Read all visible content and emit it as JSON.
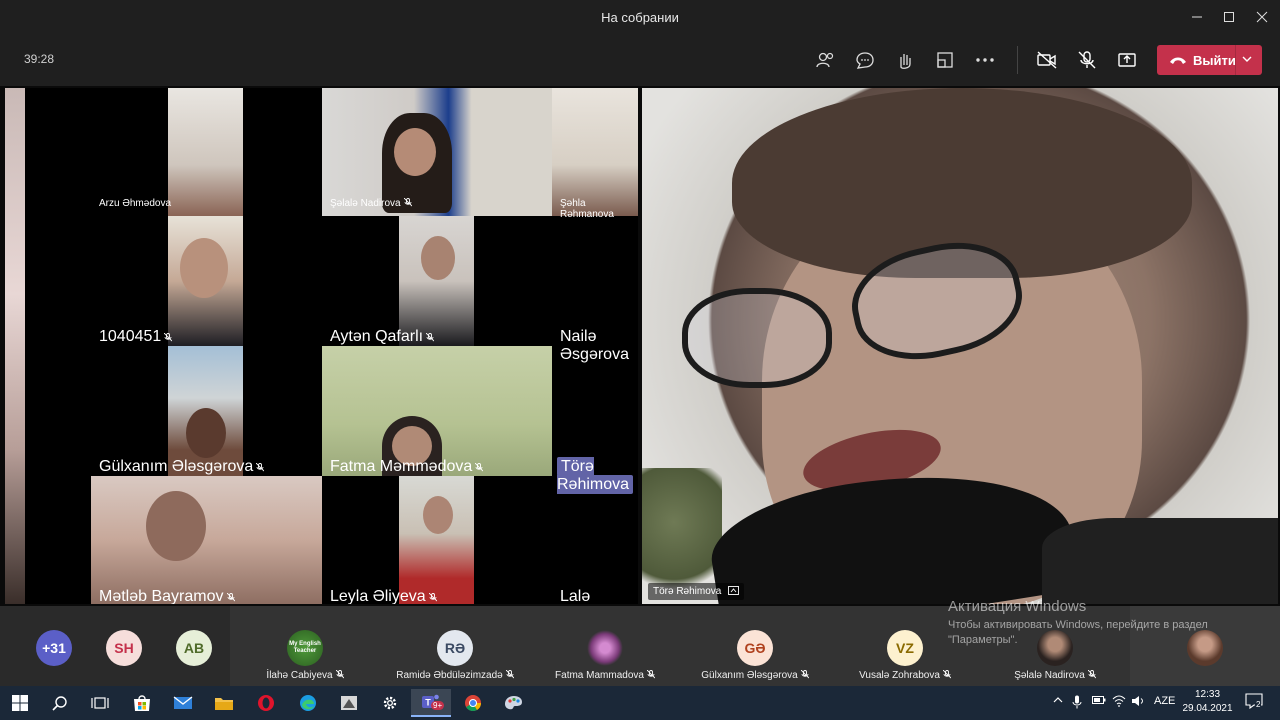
{
  "window": {
    "title": "На собрании"
  },
  "toolbar": {
    "timer": "39:28",
    "leave_label": "Выйти"
  },
  "gallery": {
    "tiles": [
      {
        "name": "Arzu Əhmədova",
        "muted": false
      },
      {
        "name": "Şəlalə Nadirova",
        "muted": true
      },
      {
        "name": "Şəhla Rəhmanova",
        "muted": false
      },
      {
        "name": "1040451",
        "muted": true
      },
      {
        "name": "Aytən Qafarlı",
        "muted": true
      },
      {
        "name": "Nailə Əsgərova",
        "muted": false
      },
      {
        "name": "Gülxanım Ələsgərova",
        "muted": true
      },
      {
        "name": "Fatma Məmmədova",
        "muted": true
      },
      {
        "name": "Törə Rəhimova",
        "muted": false,
        "highlighted": true
      },
      {
        "name": "Mətləb Bayramov",
        "muted": true
      },
      {
        "name": "Leyla Əliyeva",
        "muted": true
      },
      {
        "name": "Lalə Səmədova",
        "muted": false
      }
    ]
  },
  "speaker": {
    "name": "Törə Rəhimova"
  },
  "participants_row": {
    "overflow": {
      "label": "+31",
      "color": "#5b5fc7"
    },
    "avatars": [
      {
        "initials": "SH",
        "bg": "#f6dedb",
        "fg": "#c4314b"
      },
      {
        "initials": "AB",
        "bg": "#e6efd8",
        "fg": "#4f6b2a"
      }
    ],
    "tiles": [
      {
        "name": "İlahə Cabiyeva",
        "initials": "",
        "avatar": "logo"
      },
      {
        "name": "Ramidə Əbdüləzimzadə",
        "initials": "RƏ",
        "bg": "#e3e8ef",
        "fg": "#3b4a63"
      },
      {
        "name": "Fatma Mammadova",
        "initials": "",
        "avatar": "flower"
      },
      {
        "name": "Gülxanım Ələsgərova",
        "initials": "GƏ",
        "bg": "#fbe3d6",
        "fg": "#b0421f"
      },
      {
        "name": "Vusalə Zohrabova",
        "initials": "VZ",
        "bg": "#fdf1cf",
        "fg": "#8a6a00"
      },
      {
        "name": "Şəlalə Nadirova",
        "initials": "",
        "avatar": "photo"
      }
    ]
  },
  "activation": {
    "title": "Активация Windows",
    "text": "Чтобы активировать Windows, перейдите в раздел \"Параметры\"."
  },
  "taskbar": {
    "teams_badge": "9+",
    "lang": "AZE",
    "time": "12:33",
    "date": "29.04.2021",
    "notif_count": "2"
  }
}
